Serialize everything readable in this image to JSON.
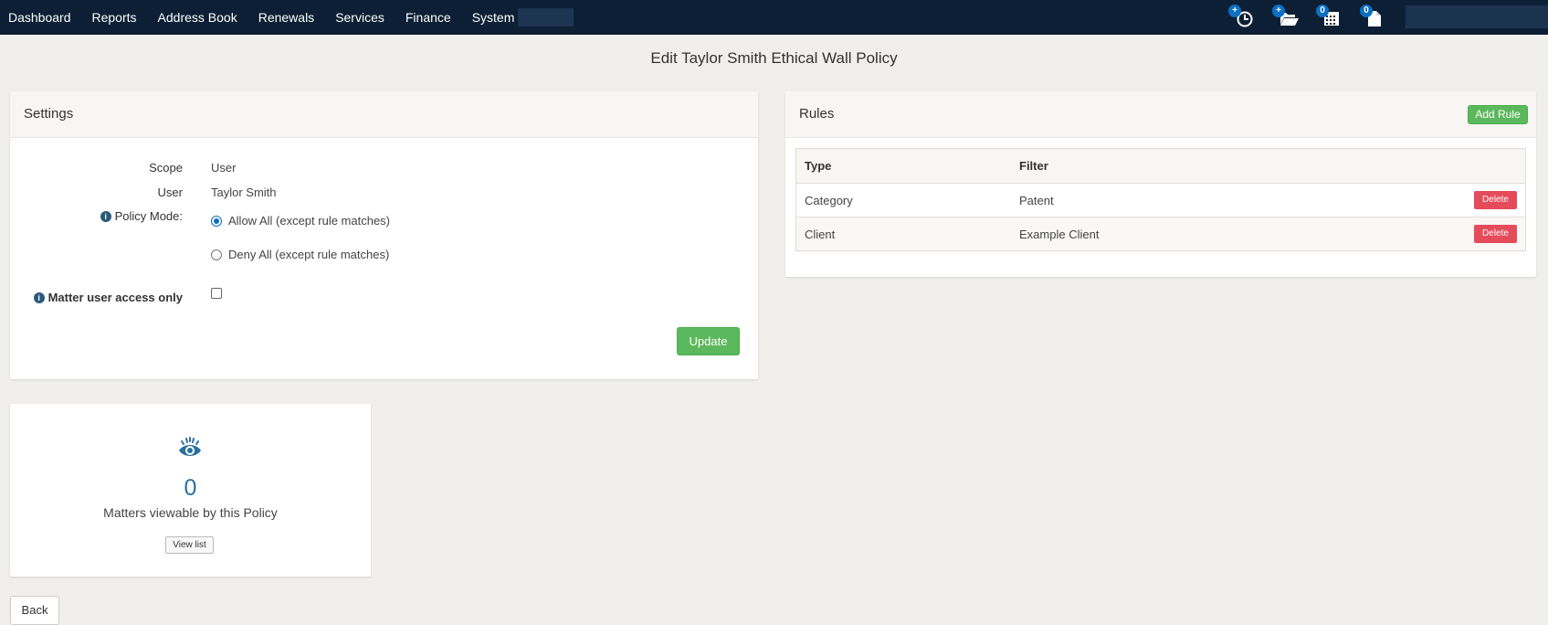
{
  "nav": {
    "items": [
      "Dashboard",
      "Reports",
      "Address Book",
      "Renewals",
      "Services",
      "Finance",
      "System"
    ],
    "icons": [
      {
        "name": "add-time-icon",
        "badge": "+"
      },
      {
        "name": "add-matter-icon",
        "badge": "+"
      },
      {
        "name": "calendar-icon",
        "badge": "0"
      },
      {
        "name": "document-icon",
        "badge": "0"
      }
    ]
  },
  "page": {
    "title": "Edit Taylor Smith Ethical Wall Policy"
  },
  "settings": {
    "title": "Settings",
    "scope_label": "Scope",
    "scope_value": "User",
    "user_label": "User",
    "user_value": "Taylor Smith",
    "policy_mode_label": "Policy Mode:",
    "policy_options": [
      "Allow All (except rule matches)",
      "Deny All (except rule matches)"
    ],
    "policy_selected": "Allow All (except rule matches)",
    "matter_access_label": "Matter user access only",
    "matter_access_checked": false,
    "update_label": "Update"
  },
  "rules": {
    "title": "Rules",
    "add_label": "Add Rule",
    "columns": [
      "Type",
      "Filter"
    ],
    "rows": [
      {
        "type": "Category",
        "filter": "Patent",
        "action": "Delete"
      },
      {
        "type": "Client",
        "filter": "Example Client",
        "action": "Delete"
      }
    ]
  },
  "matters": {
    "count": "0",
    "label": "Matters viewable by this Policy",
    "view_label": "View list"
  },
  "back_label": "Back",
  "colors": {
    "navbar": "#0c1f35",
    "accent": "#0b6fc2",
    "success": "#5cb85c",
    "danger": "#e54b5b"
  }
}
